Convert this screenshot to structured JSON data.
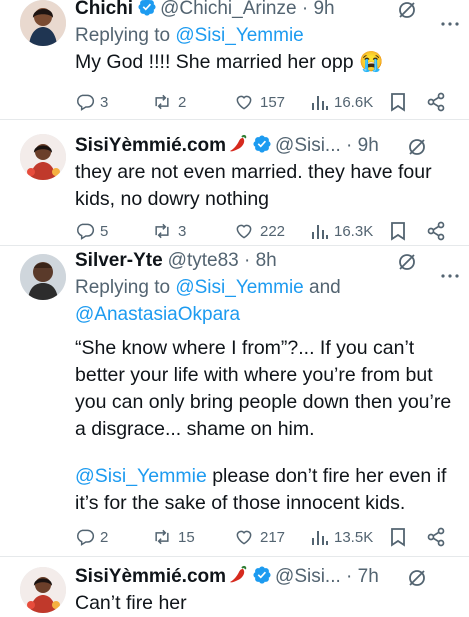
{
  "tweets": [
    {
      "name": "Chichi",
      "handle": "@Chichi_Arinze · 9h",
      "replying_prefix": "Replying to ",
      "replying_to": "@Sisi_Yemmie",
      "text": "My God !!!! She married her opp 😭",
      "replies": "3",
      "reposts": "2",
      "likes": "157",
      "views": "16.6K"
    },
    {
      "name": "SisiYèmmié.com",
      "handle": "@Sisi... · 9h",
      "text": "they are not even married. they have four kids, no dowry nothing",
      "replies": "5",
      "reposts": "3",
      "likes": "222",
      "views": "16.3K"
    },
    {
      "name": "Silver-Yte",
      "handle": "@tyte83 · 8h",
      "replying_prefix": "Replying to ",
      "replying_to": "@Sisi_Yemmie",
      "replying_join": " and",
      "replying_to_2": "@AnastasiaOkpara",
      "text_p1": "“She know where I from”?... If you can’t better your life with where you’re from but you can only bring people down then you’re a disgrace... shame on him.",
      "text_p2_mention": "@Sisi_Yemmie",
      "text_p2": " please don’t fire her even if it’s for the sake of those innocent kids.",
      "replies": "2",
      "reposts": "15",
      "likes": "217",
      "views": "13.5K"
    },
    {
      "name": "SisiYèmmié.com",
      "handle": "@Sisi... · 7h",
      "text": "Can’t fire her"
    }
  ],
  "colors": {
    "accent": "#1d9bf0",
    "secondary": "#536471",
    "verified": "#1d9bf0",
    "divider": "#e6e9eb"
  },
  "icons": [
    "verified-badge-icon",
    "chili-pepper-icon",
    "grok-icon",
    "more-icon",
    "reply-icon",
    "repost-icon",
    "like-icon",
    "views-icon",
    "bookmark-icon",
    "share-icon"
  ]
}
